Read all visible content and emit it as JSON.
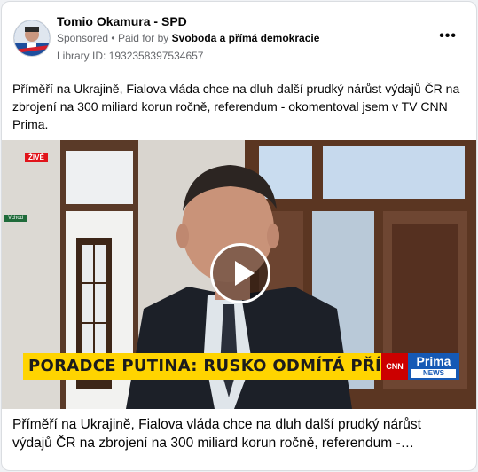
{
  "post": {
    "page_name": "Tomio Okamura - SPD",
    "sponsored": "Sponsored",
    "separator": "•",
    "paid_for_prefix": "Paid for by",
    "paid_for_by": "Svoboda a přímá demokracie",
    "library_id": "Library ID: 1932358397534657",
    "more_icon": "more-dots-icon",
    "body_text": "Příměří na Ukrajině, Fialova vláda chce na dluh další prudký nárůst výdajů ČR na zbrojení na 300 miliard korun ročně, referendum - okomentoval jsem v TV CNN Prima.",
    "caption": "Příměří na Ukrajině, Fialova vláda chce na dluh další prudký nárůst výdajů ČR na zbrojení na 300 miliard korun ročně, referendum -…"
  },
  "video": {
    "live_badge": "ŽIVĚ",
    "sign_label": "Vchod",
    "ticker": "PORADCE PUTINA: RUSKO ODMÍTÁ PŘÍMĚŘÍ",
    "cnn_logo": "CNN",
    "prima_logo": "Prima",
    "prima_news": "NEWS",
    "play_icon": "play-icon",
    "ticker_color": "#ffd400",
    "live_color": "#e1141a"
  }
}
